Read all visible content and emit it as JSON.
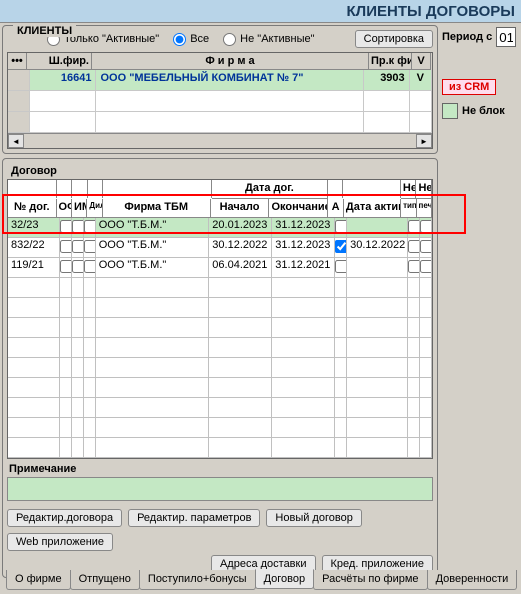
{
  "header": {
    "title": "КЛИЕНТЫ  ДОГОВОРЫ"
  },
  "clients_panel": {
    "title": "КЛИЕНТЫ",
    "radio_active": "Только \"Активные\"",
    "radio_all": "Все",
    "radio_inactive": "Не \"Активные\"",
    "sort_btn": "Сортировка",
    "headers": {
      "sh": "Ш.фир.",
      "firm": "Ф и р м а",
      "pr": "Пр.к фил.",
      "v": "V"
    },
    "rows": [
      {
        "sh": "16641",
        "firm": "ООО \"МЕБЕЛЬНЫЙ КОМБИНАТ № 7\"",
        "pr": "3903",
        "v": "V"
      }
    ]
  },
  "right_panel": {
    "period_label": "Период с",
    "period_from": "01",
    "crm_btn": "из CRM",
    "neblock": "Не блок"
  },
  "contracts": {
    "title": "Договор",
    "headers": {
      "no": "№ дог.",
      "of": "ОФ",
      "im": "ИМ",
      "diler": "Дилер",
      "firm": "Фирма ТБМ",
      "date_group": "Дата дог.",
      "start": "Начало",
      "end": "Окончание",
      "a": "А",
      "date_act": "Дата актив",
      "ne": "Не",
      "net": "Не",
      "tip": "тип.",
      "pech": "печ."
    },
    "rows": [
      {
        "no": "32/23",
        "firm": "ООО \"Т.Б.М.\"",
        "start": "20.01.2023",
        "end": "31.12.2023",
        "a": false,
        "act": ""
      },
      {
        "no": "832/22",
        "firm": "ООО \"Т.Б.М.\"",
        "start": "30.12.2022",
        "end": "31.12.2023",
        "a": true,
        "act": "30.12.2022"
      },
      {
        "no": "119/21",
        "firm": "ООО \"Т.Б.М.\"",
        "start": "06.04.2021",
        "end": "31.12.2021",
        "a": false,
        "act": ""
      }
    ],
    "note_label": "Примечание",
    "buttons": {
      "edit_contract": "Редактир.договора",
      "edit_params": "Редактир. параметров",
      "new_contract": "Новый договор",
      "web_app": "Web приложение",
      "addresses": "Адреса доставки",
      "cred_app": "Кред. приложение"
    }
  },
  "tabs": {
    "about": "О фирме",
    "shipped": "Отпущено",
    "received": "Поступило+бонусы",
    "contract": "Договор",
    "calc": "Расчёты по фирме",
    "proxy": "Доверенности"
  }
}
